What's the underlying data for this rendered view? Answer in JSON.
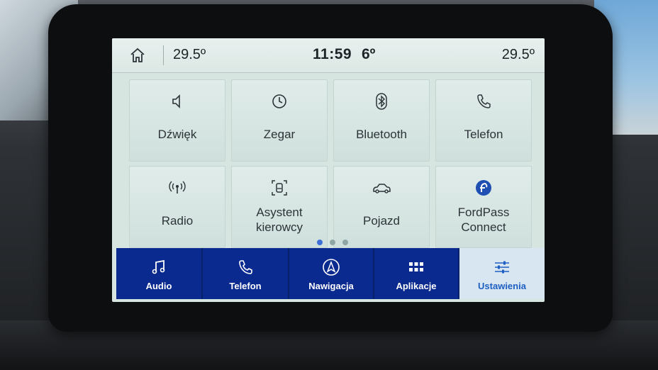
{
  "status_bar": {
    "temp_left": "29.5º",
    "clock": "11:59",
    "outside_temp": "6º",
    "temp_right": "29.5º",
    "home_icon": "home-icon"
  },
  "settings_tiles": [
    {
      "label": "Dźwięk",
      "icon": "speaker-icon"
    },
    {
      "label": "Zegar",
      "icon": "clock-icon"
    },
    {
      "label": "Bluetooth",
      "icon": "bluetooth-icon"
    },
    {
      "label": "Telefon",
      "icon": "phone-icon"
    },
    {
      "label": "Radio",
      "icon": "antenna-icon"
    },
    {
      "label": "Asystent kierowcy",
      "icon": "driver-assist-icon"
    },
    {
      "label": "Pojazd",
      "icon": "car-icon"
    },
    {
      "label": "FordPass Connect",
      "icon": "fordpass-icon"
    }
  ],
  "pagination": {
    "pages": 3,
    "active": 1
  },
  "bottom_nav": [
    {
      "label": "Audio",
      "icon": "music-note-icon"
    },
    {
      "label": "Telefon",
      "icon": "phone-icon"
    },
    {
      "label": "Nawigacja",
      "icon": "navigation-arrow-icon"
    },
    {
      "label": "Aplikacje",
      "icon": "apps-grid-icon"
    },
    {
      "label": "Ustawienia",
      "icon": "settings-sliders-icon",
      "active": true
    }
  ],
  "colors": {
    "nav_background": "#0b2a8f",
    "active_tab_text": "#1e5fc4",
    "page_dot_active": "#3d6fd6"
  }
}
